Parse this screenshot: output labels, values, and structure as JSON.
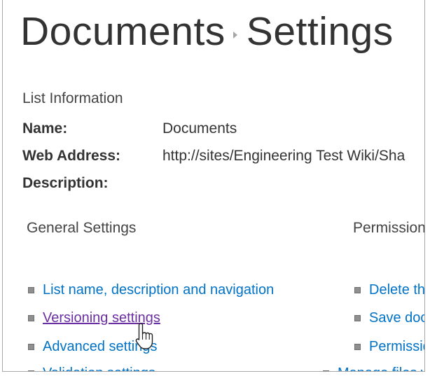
{
  "header": {
    "breadcrumb_root": "Documents",
    "breadcrumb_current": "Settings"
  },
  "list_information": {
    "heading": "List Information",
    "name_label": "Name:",
    "name_value": "Documents",
    "web_address_label": "Web Address:",
    "web_address_value": "http://sites/Engineering Test Wiki/Sha",
    "description_label": "Description:",
    "description_value": ""
  },
  "general_settings": {
    "heading": "General Settings",
    "links": [
      "List name, description and navigation",
      "Versioning settings",
      "Advanced settings",
      "Validation settings"
    ]
  },
  "permissions": {
    "heading": "Permission",
    "links": [
      "Delete th",
      "Save doc",
      "Permissio",
      "Manage files w"
    ]
  },
  "colors": {
    "link": "#0072c6",
    "link_hover": "#6b2fa3",
    "text": "#333333"
  },
  "icons": {
    "cursor": "hand-pointer-icon",
    "separator": "chevron-right-icon",
    "bullet": "square-bullet-icon"
  }
}
